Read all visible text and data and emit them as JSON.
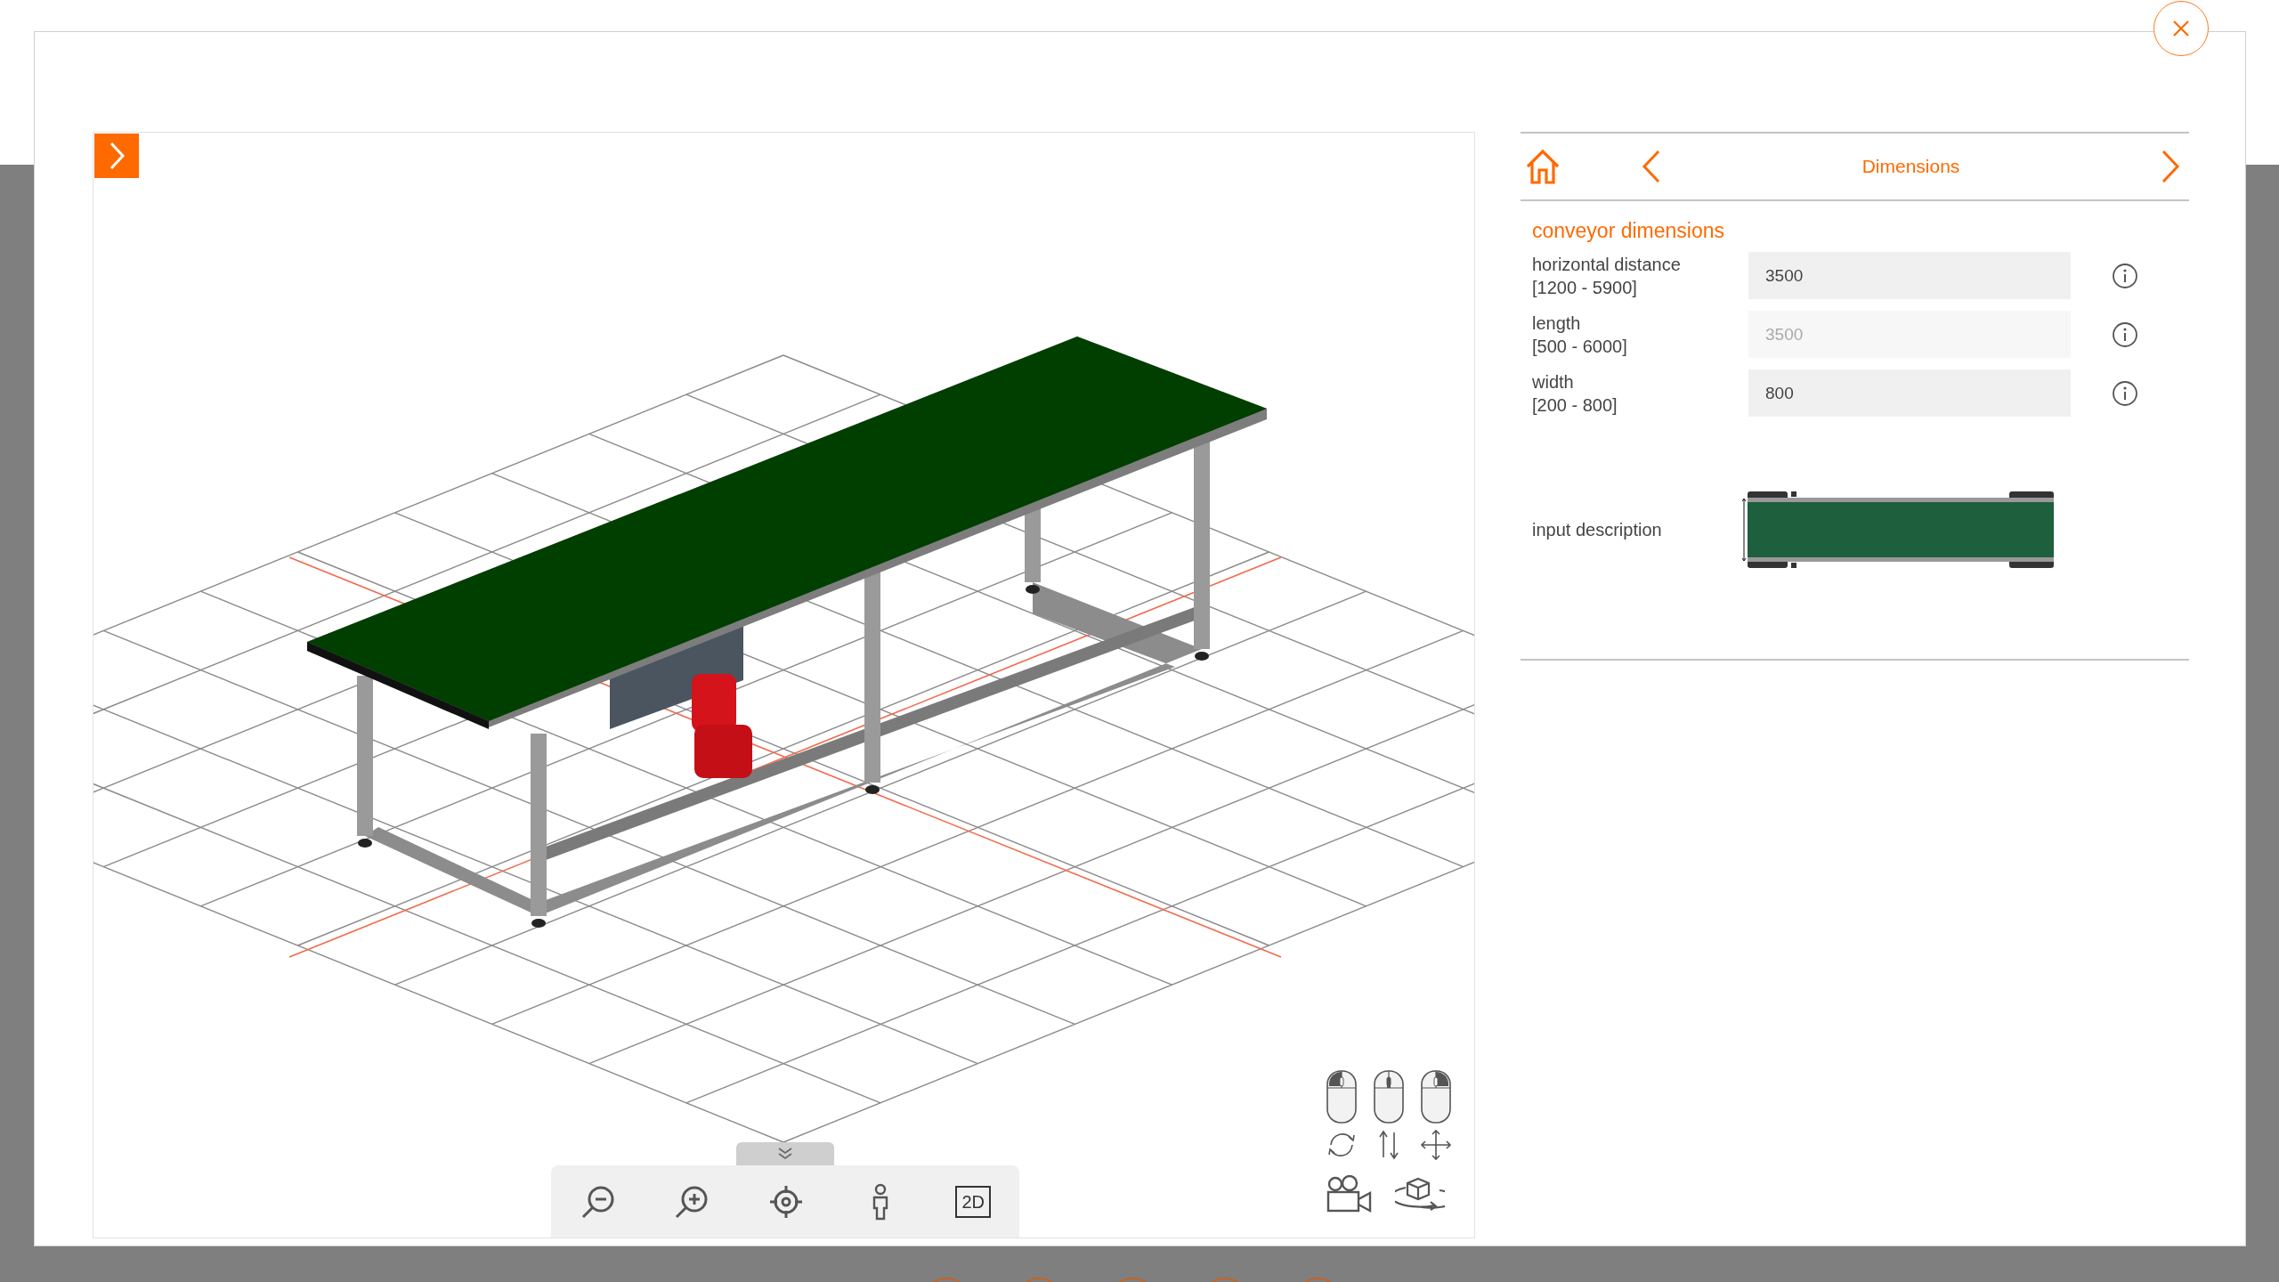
{
  "nav": {
    "title": "Dimensions"
  },
  "section_title": "conveyor dimensions",
  "fields": [
    {
      "label": "horizontal distance",
      "range": "[1200 - 5900]",
      "value": "3500",
      "disabled": false
    },
    {
      "label": "length",
      "range": "[500 - 6000]",
      "value": "3500",
      "disabled": true
    },
    {
      "label": "width",
      "range": "[200 - 800]",
      "value": "800",
      "disabled": false
    }
  ],
  "input_description": {
    "label": "input description"
  },
  "toolbar": [
    {
      "kind": "zoom_out"
    },
    {
      "kind": "zoom_in"
    },
    {
      "kind": "center"
    },
    {
      "kind": "person"
    },
    {
      "kind": "view_2d",
      "label": "2D"
    }
  ],
  "mouse_hints": [
    {
      "kind": "left"
    },
    {
      "kind": "middle"
    },
    {
      "kind": "right"
    }
  ],
  "view_buttons": [
    {
      "kind": "camera"
    },
    {
      "kind": "orbit"
    }
  ]
}
